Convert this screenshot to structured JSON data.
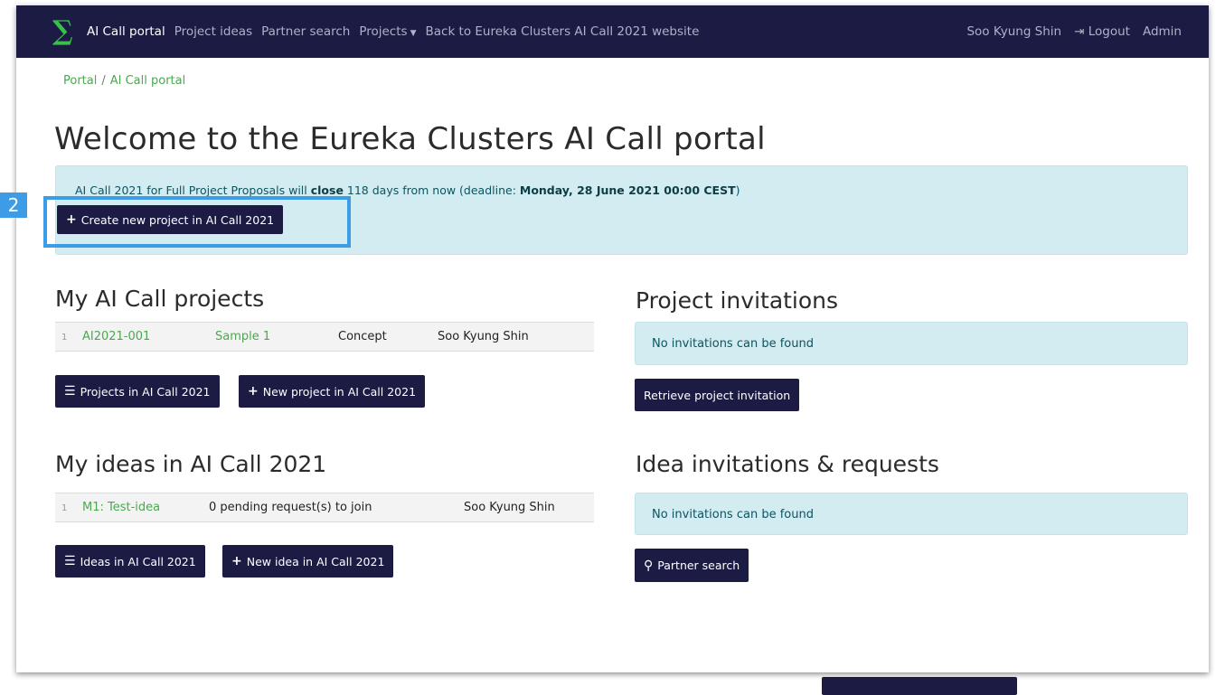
{
  "nav": {
    "brand_icon": "sigma-icon",
    "links": [
      "AI Call portal",
      "Project ideas",
      "Partner search",
      "Projects",
      "Back to Eureka Clusters AI Call 2021 website"
    ],
    "user": "Soo Kyung Shin",
    "logout": "Logout",
    "admin": "Admin"
  },
  "breadcrumb": {
    "root": "Portal",
    "sep": "/",
    "current": "AI Call portal"
  },
  "page_title": "Welcome to the Eureka Clusters AI Call portal",
  "alert": {
    "text_prefix": "AI Call 2021 for Full Project Proposals will ",
    "close_word": "close",
    "text_mid": " 118 days from now (deadline: ",
    "deadline": "Monday, 28 June 2021 00:00 CEST",
    "text_suffix": ")",
    "create_button": "Create new project in AI Call 2021"
  },
  "annotation": {
    "step": "2"
  },
  "my_projects": {
    "title": "My AI Call projects",
    "rows": [
      {
        "index": "1",
        "code": "AI2021-001",
        "name": "Sample 1",
        "status": "Concept",
        "owner": "Soo Kyung Shin"
      }
    ],
    "list_button": "Projects in AI Call 2021",
    "new_button": "New project in AI Call 2021"
  },
  "project_invitations": {
    "title": "Project invitations",
    "empty": "No invitations can be found",
    "retrieve_button": "Retrieve project invitation"
  },
  "my_ideas": {
    "title": "My ideas in AI Call 2021",
    "rows": [
      {
        "index": "1",
        "name": "M1: Test-idea",
        "pending": "0 pending request(s) to join",
        "owner": "Soo Kyung Shin"
      }
    ],
    "list_button": "Ideas in AI Call 2021",
    "new_button": "New idea in AI Call 2021"
  },
  "idea_invitations": {
    "title": "Idea invitations & requests",
    "empty": "No invitations can be found",
    "search_button": "Partner search"
  },
  "colors": {
    "navbar": "#1b1b44",
    "accent_green": "#4aa84f",
    "info_bg": "#d3ecf1",
    "highlight": "#3c9ce5"
  }
}
